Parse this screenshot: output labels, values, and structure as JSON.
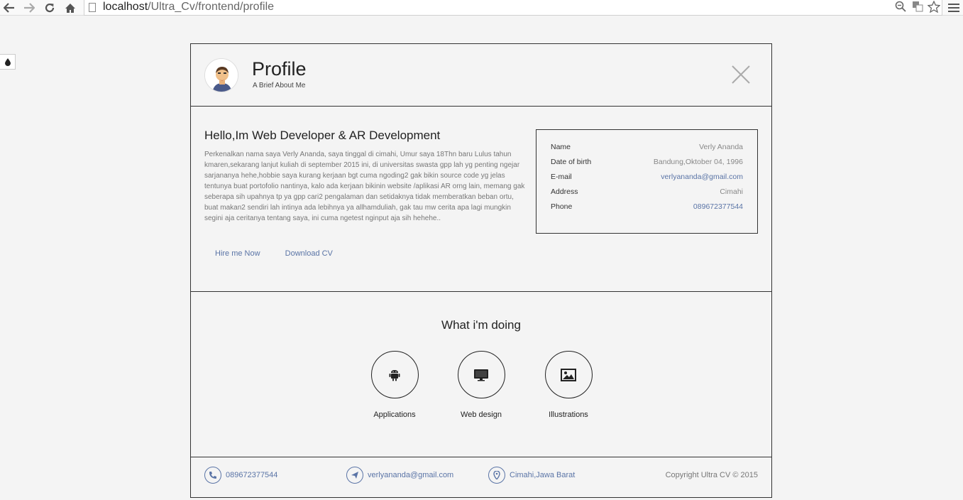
{
  "browser": {
    "url_host": "localhost",
    "url_path": "/Ultra_Cv/frontend/profile"
  },
  "header": {
    "title": "Profile",
    "subtitle": "A Brief About Me"
  },
  "about": {
    "heading": "Hello,Im Web Developer & AR Development",
    "text": "Perkenalkan nama saya Verly Ananda, saya tinggal di cimahi, Umur saya 18Thn baru Lulus tahun kmaren,sekarang lanjut kuliah di september 2015 ini, di universitas swasta gpp lah yg penting ngejar sarjananya hehe,hobbie saya kurang kerjaan bgt cuma ngoding2 gak bikin source code yg jelas tentunya buat portofolio nantinya, kalo ada kerjaan bikinin website /aplikasi AR orng lain, memang gak seberapa sih upahnya tp ya gpp cari2 pengalaman dan setidaknya tidak memberatkan beban ortu, buat makan2 sendiri lah intinya ada lebihnya ya allhamduliah, gak tau mw cerita apa lagi mungkin segini aja ceritanya tentang saya, ini cuma ngetest nginput aja sih hehehe..",
    "hire_label": "Hire me Now",
    "download_label": "Download CV"
  },
  "info": {
    "rows": [
      {
        "label": "Name",
        "value": "Verly Ananda"
      },
      {
        "label": "Date of birth",
        "value": "Bandung,Oktober 04, 1996"
      },
      {
        "label": "E-mail",
        "value": "verlyananda@gmail.com"
      },
      {
        "label": "Address",
        "value": "Cimahi"
      },
      {
        "label": "Phone",
        "value": "089672377544"
      }
    ]
  },
  "doing": {
    "heading": "What i'm doing",
    "services": [
      {
        "label": "Applications",
        "icon": "android-icon"
      },
      {
        "label": "Web design",
        "icon": "monitor-icon"
      },
      {
        "label": "Illustrations",
        "icon": "image-icon"
      }
    ]
  },
  "footer": {
    "phone": "089672377544",
    "email": "verlyananda@gmail.com",
    "location": "Cimahi,Jawa Barat",
    "copyright": "Copyright Ultra CV © 2015"
  },
  "colors": {
    "accent": "#5a74a6",
    "background": "#f4f4f4",
    "border": "#333333"
  }
}
